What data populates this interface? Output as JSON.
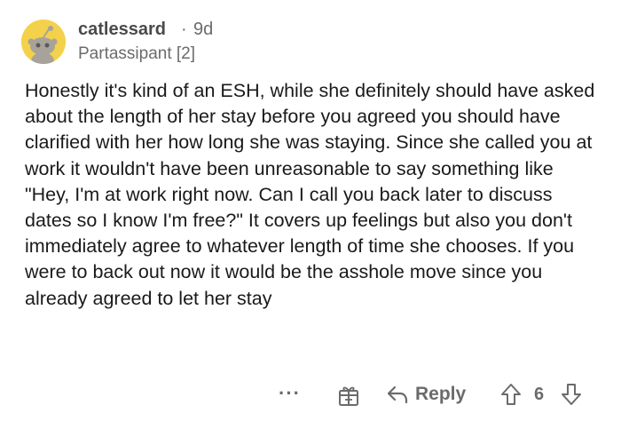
{
  "comment": {
    "author": "catlessard",
    "separator": "·",
    "age": "9d",
    "flair": "Partassipant [2]",
    "body": "Honestly it's kind of an ESH, while she definitely should have asked about the length of her stay before you agreed you should have clarified with her how long she was staying. Since she called you at work it wouldn't have been unreasonable to say something like \"Hey, I'm at work right now. Can I call you back later to discuss dates so I know I'm free?\" It covers up feelings but also you don't immediately agree to whatever length of time she chooses. If you were to back out now it would be the asshole move since you already agreed to let her stay",
    "avatar_color": "#f3d14a"
  },
  "actions": {
    "more_label": "···",
    "more_icon": "more-dots-icon",
    "award_icon": "gift-award-icon",
    "reply_icon": "reply-arrow-icon",
    "reply_label": "Reply",
    "upvote_icon": "upvote-arrow-icon",
    "score": "6",
    "downvote_icon": "downvote-arrow-icon"
  },
  "colors": {
    "text": "#1a1a1b",
    "meta": "#6b6b6b",
    "username": "#4a4a4a"
  }
}
